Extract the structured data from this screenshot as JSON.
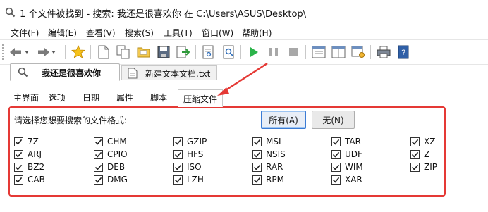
{
  "window": {
    "title": "1 个文件被找到 - 搜索: 我还是很喜欢你 在 C:\\Users\\ASUS\\Desktop\\"
  },
  "menu": [
    "文件(F)",
    "编辑(E)",
    "查看(V)",
    "搜索(S)",
    "工具(T)",
    "窗口(W)",
    "帮助(H)"
  ],
  "doc_tabs": {
    "active": "我还是很喜欢你",
    "inactive": "新建文本文档.txt"
  },
  "option_tabs": [
    "主界面",
    "选项",
    "日期",
    "属性",
    "脚本",
    "压缩文件"
  ],
  "archive": {
    "prompt": "请选择您想要搜索的文件格式:",
    "all_button": "所有(A)",
    "none_button": "无(N)",
    "columns": [
      [
        {
          "label": "7Z",
          "checked": true
        },
        {
          "label": "ARJ",
          "checked": true
        },
        {
          "label": "BZ2",
          "checked": true
        },
        {
          "label": "CAB",
          "checked": true
        }
      ],
      [
        {
          "label": "CHM",
          "checked": true
        },
        {
          "label": "CPIO",
          "checked": true
        },
        {
          "label": "DEB",
          "checked": true
        },
        {
          "label": "DMG",
          "checked": true
        }
      ],
      [
        {
          "label": "GZIP",
          "checked": true
        },
        {
          "label": "HFS",
          "checked": true
        },
        {
          "label": "ISO",
          "checked": true
        },
        {
          "label": "LZH",
          "checked": true
        }
      ],
      [
        {
          "label": "MSI",
          "checked": true
        },
        {
          "label": "NSIS",
          "checked": true
        },
        {
          "label": "RAR",
          "checked": true
        },
        {
          "label": "RPM",
          "checked": true
        }
      ],
      [
        {
          "label": "TAR",
          "checked": true
        },
        {
          "label": "UDF",
          "checked": true
        },
        {
          "label": "WIM",
          "checked": true
        },
        {
          "label": "XAR",
          "checked": true
        }
      ],
      [
        {
          "label": "XZ",
          "checked": true
        },
        {
          "label": "Z",
          "checked": true
        },
        {
          "label": "ZIP",
          "checked": true
        }
      ]
    ]
  },
  "colors": {
    "highlight_red": "#e53935"
  }
}
